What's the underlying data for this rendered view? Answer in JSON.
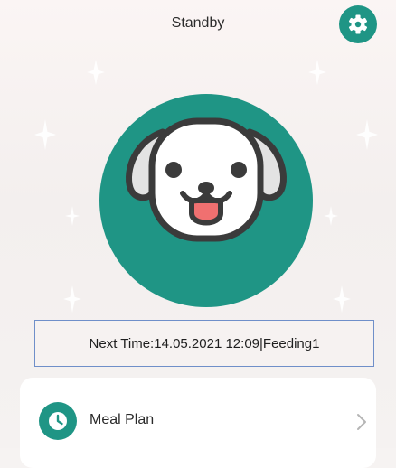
{
  "header": {
    "title": "Standby",
    "settings_icon": "gear-icon"
  },
  "avatar": {
    "icon": "dog-face-icon",
    "accent": "#1f9585"
  },
  "schedule": {
    "next_time_text": "Next Time:14.05.2021 12:09|Feeding1"
  },
  "menu": {
    "items": [
      {
        "label": "Meal Plan",
        "icon": "clock-icon",
        "trailing_icon": "chevron-right-icon"
      }
    ]
  },
  "colors": {
    "accent": "#1f9585",
    "background": "#f6f3f2",
    "card": "#ffffff",
    "box_border": "#6f8fc9"
  }
}
